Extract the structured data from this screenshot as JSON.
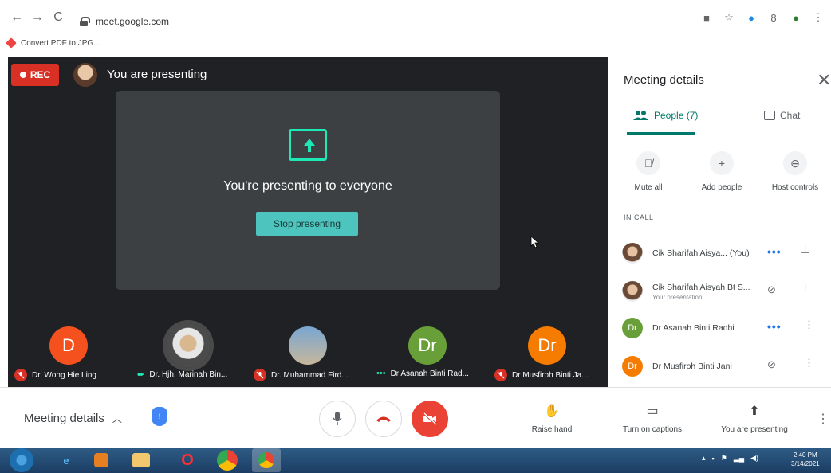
{
  "browser": {
    "url": "meet.google.com",
    "bookmark": "Convert PDF to JPG..."
  },
  "stage": {
    "rec_label": "REC",
    "presenting_header": "You are presenting",
    "presenting_message": "You're presenting to everyone",
    "stop_button": "Stop presenting"
  },
  "participants_strip": [
    {
      "initial": "D",
      "name": "Dr. Wong Hie Ling",
      "color": "#f4511e",
      "muted": true
    },
    {
      "initial": "",
      "name": "Dr. Hjh. Marinah Bin...",
      "color": "#b0a28a",
      "muted": false
    },
    {
      "initial": "",
      "name": "Dr. Muhammad Fird...",
      "color": "#5b7fa6",
      "muted": true
    },
    {
      "initial": "Dr",
      "name": "Dr Asanah Binti Rad...",
      "color": "#689f38",
      "muted": false
    },
    {
      "initial": "Dr",
      "name": "Dr Musfiroh Binti Ja...",
      "color": "#f57c00",
      "muted": true
    }
  ],
  "panel": {
    "title": "Meeting details",
    "tab_people": "People (7)",
    "tab_chat": "Chat",
    "mute_all": "Mute all",
    "add_people": "Add people",
    "host_controls": "Host controls",
    "in_call": "IN CALL",
    "people": [
      {
        "initial": "",
        "name": "Cik Sharifah Aisya... (You)",
        "sub": "",
        "color": "#ffffff"
      },
      {
        "initial": "",
        "name": "Cik Sharifah Aisyah Bt S...",
        "sub": "Your presentation",
        "color": "#ffffff"
      },
      {
        "initial": "Dr",
        "name": "Dr Asanah Binti Radhi",
        "sub": "",
        "color": "#689f38"
      },
      {
        "initial": "Dr",
        "name": "Dr Musfiroh Binti Jani",
        "sub": "",
        "color": "#f57c00"
      }
    ]
  },
  "bottom": {
    "meeting_details": "Meeting details",
    "raise_hand": "Raise hand",
    "captions": "Turn on captions",
    "presenting": "You are presenting"
  },
  "taskbar": {
    "time": "2:40 PM",
    "date": "3/14/2021"
  }
}
